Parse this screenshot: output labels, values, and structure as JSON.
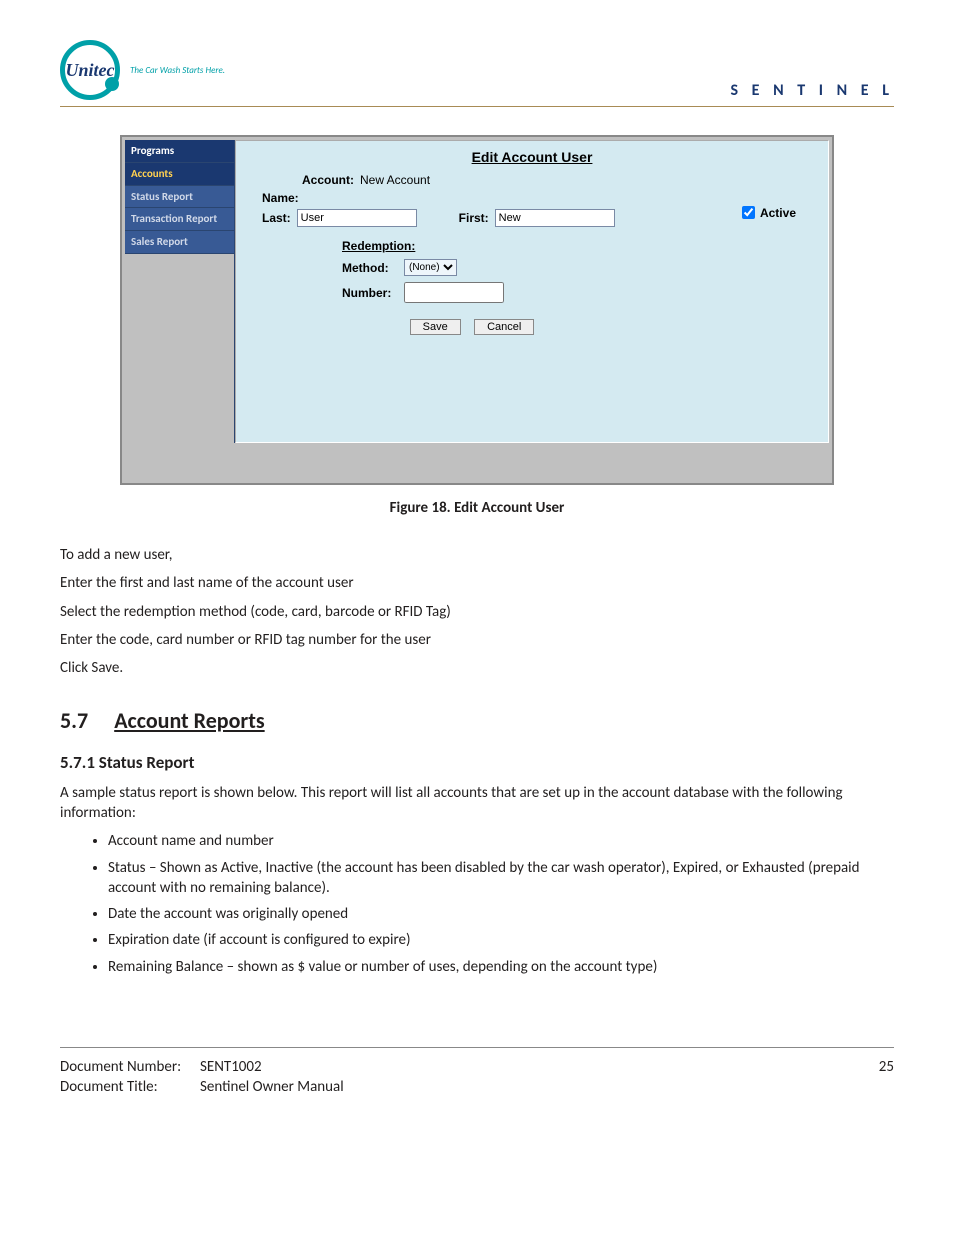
{
  "header": {
    "logo_text": "Unitec",
    "logo_tagline": "The Car Wash Starts Here.",
    "right_brand": "S E N T I N E L"
  },
  "screenshot": {
    "sidebar": {
      "items": [
        {
          "label": "Programs",
          "kind": "h"
        },
        {
          "label": "Accounts",
          "kind": "sel"
        },
        {
          "label": "Status Report",
          "kind": ""
        },
        {
          "label": "Transaction Report",
          "kind": ""
        },
        {
          "label": "Sales Report",
          "kind": ""
        }
      ]
    },
    "panel": {
      "title": "Edit Account User",
      "account_label": "Account:",
      "account_value": "New Account",
      "name_label": "Name:",
      "last_label": "Last:",
      "last_value": "User",
      "first_label": "First:",
      "first_value": "New",
      "active_label": "Active",
      "active_checked": true,
      "redemption_header": "Redemption:",
      "method_label": "Method:",
      "method_value": "(None)",
      "number_label": "Number:",
      "number_value": "",
      "save_label": "Save",
      "cancel_label": "Cancel"
    }
  },
  "figure_caption": "Figure 18. Edit Account User",
  "body": {
    "intro": "To add a new user,",
    "steps": [
      "Enter the first and last name of the account user",
      "Select the redemption method (code, card, barcode or RFID Tag)",
      "Enter the code, card number or RFID tag number for the user",
      "Click Save."
    ],
    "section_number": "5.7",
    "section_title": "Account Reports",
    "subsection_number": "5.7.1",
    "subsection_title": "Status Report",
    "status_report_intro": "A sample status report is shown below. This report will list all accounts that are set up in the account database with the following information:",
    "bullets": [
      "Account name and number",
      "Status – Shown as Active, Inactive (the account has been disabled by the car wash operator), Expired, or Exhausted (prepaid account with no remaining balance).",
      "Date the account was originally opened",
      "Expiration date (if account is configured to expire)",
      "Remaining Balance – shown as $ value or number of uses, depending on the account type)"
    ]
  },
  "footer": {
    "doc_num_label": "Document Number:",
    "doc_num_value": "SENT1002",
    "doc_title_label": "Document Title:",
    "doc_title_value": "Sentinel Owner Manual",
    "page_number": "25"
  }
}
